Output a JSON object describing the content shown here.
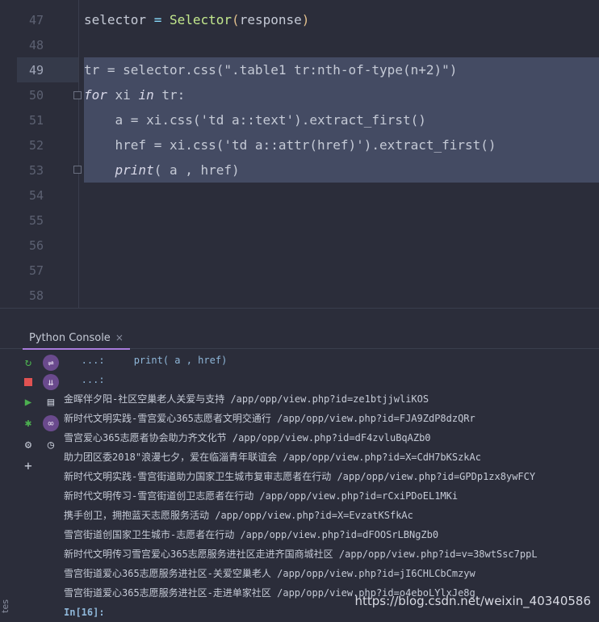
{
  "editor": {
    "lines": [
      {
        "num": "47",
        "segments": [
          [
            "selector ",
            ""
          ],
          [
            "=",
            "op"
          ],
          [
            " ",
            ""
          ],
          [
            "Selector",
            "fn"
          ],
          [
            "(",
            "paren"
          ],
          [
            "response",
            "param"
          ],
          [
            ")",
            "paren"
          ]
        ]
      },
      {
        "num": "48",
        "segments": []
      },
      {
        "num": "49",
        "segments": [
          [
            "tr = selector.css(\".table1 tr:nth-of-type(n+2)\")",
            ""
          ]
        ]
      },
      {
        "num": "50",
        "segments": [
          [
            "for",
            "kw"
          ],
          [
            " xi ",
            ""
          ],
          [
            "in",
            "kw"
          ],
          [
            " tr:",
            ""
          ]
        ]
      },
      {
        "num": "51",
        "segments": [
          [
            "    a = xi.css('td a::text').extract_first()",
            ""
          ]
        ]
      },
      {
        "num": "52",
        "segments": [
          [
            "    href = xi.css('td a::attr(href)').extract_first()",
            ""
          ]
        ]
      },
      {
        "num": "53",
        "segments": [
          [
            "    ",
            ""
          ],
          [
            "print",
            "kw"
          ],
          [
            "( a , href)",
            ""
          ]
        ]
      },
      {
        "num": "54",
        "segments": []
      },
      {
        "num": "55",
        "segments": []
      },
      {
        "num": "56",
        "segments": []
      },
      {
        "num": "57",
        "segments": []
      },
      {
        "num": "58",
        "segments": []
      }
    ]
  },
  "console": {
    "tab_label": "Python Console",
    "tab_close": "×",
    "continuation_1": "   ...:     print( a , href)",
    "continuation_2": "   ...:",
    "output": [
      "金晖伴夕阳-社区空巢老人关爱与支持 /app/opp/view.php?id=ze1btjjwliKOS",
      "新时代文明实践-雪宫爱心365志愿者文明交通行 /app/opp/view.php?id=FJA9ZdP8dzQRr",
      "雪宫爱心365志愿者协会助力齐文化节 /app/opp/view.php?id=dF4zvluBqAZb0",
      "助力团区委2018\"浪漫七夕，爱在临淄青年联谊会 /app/opp/view.php?id=X=CdH7bKSzkAc",
      "新时代文明实践-雪宫街道助力国家卫生城市复审志愿者在行动 /app/opp/view.php?id=GPDp1zx8ywFCY",
      "新时代文明传习-雪宫街道创卫志愿者在行动 /app/opp/view.php?id=rCxiPDoEL1MKi",
      "携手创卫，拥抱蓝天志愿服务活动 /app/opp/view.php?id=X=EvzatKSfkAc",
      "雪宫街道创国家卫生城市-志愿者在行动 /app/opp/view.php?id=dFOOSrLBNgZb0",
      "新时代文明传习雪宫爱心365志愿服务进社区走进齐国商城社区 /app/opp/view.php?id=v=38wtSsc7ppL",
      "雪宫街道爱心365志愿服务进社区-关爱空巢老人 /app/opp/view.php?id=jI6CHLCbCmzyw",
      "雪宫街道爱心365志愿服务进社区-走进单家社区 /app/opp/view.php?id=o4eboLYlxJe8g"
    ],
    "in_prompt": "In[16]:"
  },
  "watermark": "https://blog.csdn.net/weixin_40340586",
  "side_label": "tes",
  "colors": {
    "background": "#2b2d3a",
    "selection": "#444b63",
    "accent": "#a77bdb",
    "run": "#4caf50",
    "stop": "#e05252"
  }
}
